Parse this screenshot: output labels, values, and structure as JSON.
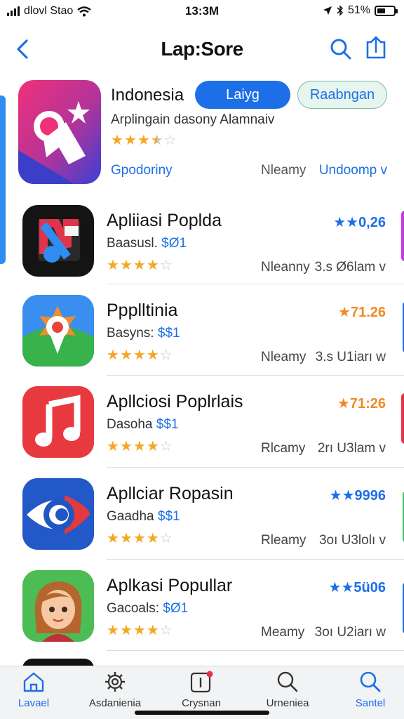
{
  "status_bar": {
    "carrier": "dlovl Stao",
    "time": "13:3M",
    "battery": "51%",
    "battery_level": 0.51
  },
  "nav": {
    "title": "Lap:Sore"
  },
  "featured": {
    "title": "Indonesia",
    "primary_button": "Laiyg",
    "secondary_button": "Raabngan",
    "subtitle": "Arplingain dasony Alamnaiv",
    "rating_stars": 3.5,
    "link": "Gpodoriny",
    "meta_mid": "Nleamy",
    "meta_right": "Undoomp v"
  },
  "apps": [
    {
      "name": "Apliiasi Poplda",
      "price_label": "Baasusl.",
      "price": "$Ø1",
      "rating": "★★0,26",
      "rating_color": "#1d6fe8",
      "stars": 4,
      "meta_mid": "Nleanny",
      "meta_right": "3.s Ø6lam v"
    },
    {
      "name": "Ppplltinia",
      "price_label": "Basyns:",
      "price": "$$1",
      "rating": "★71.26",
      "rating_color": "#f08a24",
      "stars": 4,
      "meta_mid": "Nleamy",
      "meta_right": "3.s U1iarı w"
    },
    {
      "name": "Apllciosi Poplrlais",
      "price_label": "Dasoha",
      "price": "$$1",
      "rating": "★71:26",
      "rating_color": "#f08a24",
      "stars": 4,
      "meta_mid": "Rlcamy",
      "meta_right": "2rı U3lam v"
    },
    {
      "name": "Apllciar Ropasin",
      "price_label": "Gaadha",
      "price": "$$1",
      "rating": "★★9996",
      "rating_color": "#1d6fe8",
      "stars": 4,
      "meta_mid": "Rleamy",
      "meta_right": "3oı U3lolı v"
    },
    {
      "name": "Aplkasi Popullar",
      "price_label": "Gacoals:",
      "price": "$Ø1",
      "rating": "★★5ü06",
      "rating_color": "#1d6fe8",
      "stars": 4,
      "meta_mid": "Meamy",
      "meta_right": "3oı U2iarı w"
    }
  ],
  "tabs": [
    {
      "label": "Lavael",
      "icon": "home-icon",
      "active": true
    },
    {
      "label": "Asdanienia",
      "icon": "gear-icon",
      "active": false
    },
    {
      "label": "Crysnan",
      "icon": "updates-icon",
      "active": false
    },
    {
      "label": "Urneniea",
      "icon": "search-icon",
      "active": false
    },
    {
      "label": "Santel",
      "icon": "search-icon",
      "active": true
    }
  ],
  "colors": {
    "accent": "#1d6fe8",
    "star": "#f5a623"
  }
}
